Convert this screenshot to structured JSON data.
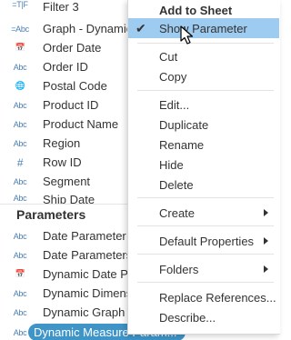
{
  "fields": [
    {
      "icon": "=T|F",
      "label": "Filter 3",
      "icon_name": "boolean-calc-icon"
    },
    {
      "icon": "=Abc",
      "label": "Graph - Dynamic",
      "icon_name": "string-calc-icon"
    },
    {
      "icon": "📅",
      "label": "Order Date",
      "icon_name": "date-icon"
    },
    {
      "icon": "Abc",
      "label": "Order ID",
      "icon_name": "string-icon"
    },
    {
      "icon": "🌐",
      "label": "Postal Code",
      "icon_name": "geographic-icon"
    },
    {
      "icon": "Abc",
      "label": "Product ID",
      "icon_name": "string-icon"
    },
    {
      "icon": "Abc",
      "label": "Product Name",
      "icon_name": "string-icon"
    },
    {
      "icon": "Abc",
      "label": "Region",
      "icon_name": "string-icon"
    },
    {
      "icon": "#",
      "label": "Row ID",
      "icon_name": "number-icon"
    },
    {
      "icon": "Abc",
      "label": "Segment",
      "icon_name": "string-icon"
    },
    {
      "icon": "Abc",
      "label": "Ship Date",
      "icon_name": "string-icon"
    }
  ],
  "parameters_title": "Parameters",
  "parameters": [
    {
      "icon": "Abc",
      "label": "Date Parameter",
      "icon_name": "string-icon"
    },
    {
      "icon": "Abc",
      "label": "Date Parameters",
      "icon_name": "string-icon"
    },
    {
      "icon": "📅",
      "label": "Dynamic Date Pa",
      "icon_name": "date-icon"
    },
    {
      "icon": "Abc",
      "label": "Dynamic Dimens",
      "icon_name": "string-icon"
    },
    {
      "icon": "Abc",
      "label": "Dynamic Graph F",
      "icon_name": "string-icon"
    },
    {
      "icon": "Abc",
      "label": "Dynamic Measure Param...",
      "icon_name": "string-icon"
    }
  ],
  "menu": {
    "add_to_sheet": "Add to Sheet",
    "show_parameter": "Show Parameter",
    "show_parameter_checked": "✔",
    "cut": "Cut",
    "copy": "Copy",
    "edit": "Edit...",
    "duplicate": "Duplicate",
    "rename": "Rename",
    "hide": "Hide",
    "delete": "Delete",
    "create": "Create",
    "default_properties": "Default Properties",
    "folders": "Folders",
    "replace_references": "Replace References...",
    "describe": "Describe..."
  },
  "colors": {
    "highlight": "#9ecbf0",
    "selected_pill": "#3f94c8",
    "icon_blue": "#4a7fb5",
    "icon_teal": "#47a5a0"
  }
}
